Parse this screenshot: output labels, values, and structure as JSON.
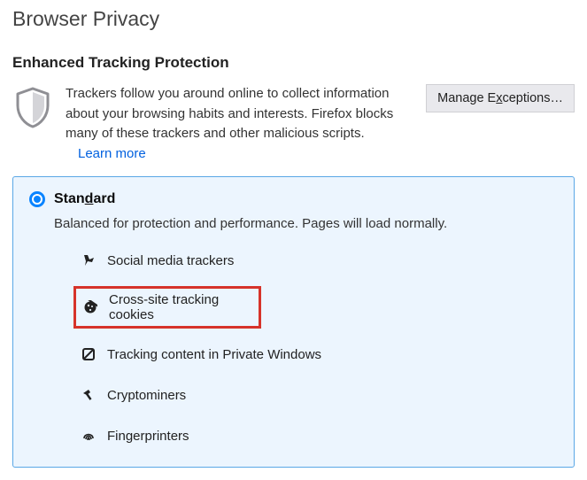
{
  "page_title": "Browser Privacy",
  "section_title": "Enhanced Tracking Protection",
  "intro": {
    "text": "Trackers follow you around online to collect information about your browsing habits and interests. Firefox blocks many of these trackers and other malicious scripts.",
    "learn_more": "Learn more",
    "manage_btn_prefix": "Manage E",
    "manage_btn_underline": "x",
    "manage_btn_suffix": "ceptions…"
  },
  "standard": {
    "title_prefix": "Stan",
    "title_underline": "d",
    "title_suffix": "ard",
    "selected": true,
    "desc": "Balanced for protection and performance. Pages will load normally.",
    "items": [
      {
        "icon": "social-icon",
        "label": "Social media trackers",
        "highlight": false
      },
      {
        "icon": "cookie-icon",
        "label": "Cross-site tracking cookies",
        "highlight": true
      },
      {
        "icon": "private-icon",
        "label": "Tracking content in Private Windows",
        "highlight": false
      },
      {
        "icon": "cryptominer-icon",
        "label": "Cryptominers",
        "highlight": false
      },
      {
        "icon": "fingerprint-icon",
        "label": "Fingerprinters",
        "highlight": false
      }
    ]
  }
}
